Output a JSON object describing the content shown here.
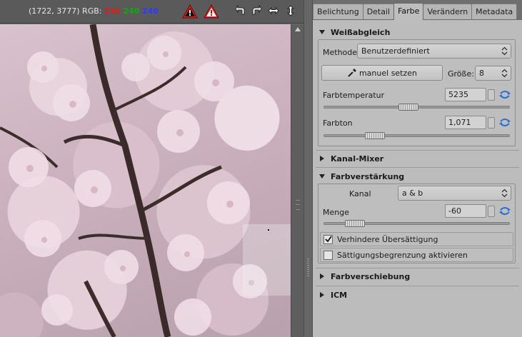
{
  "toolbar": {
    "readout_prefix": "(1722, 3777) RGB:",
    "r": "240",
    "g": "240",
    "b": "240"
  },
  "tabs": [
    {
      "label": "Belichtung"
    },
    {
      "label": "Detail"
    },
    {
      "label": "Farbe",
      "active": true
    },
    {
      "label": "Verändern"
    },
    {
      "label": "Metadata"
    }
  ],
  "white_balance": {
    "title": "Weißabgleich",
    "method_label": "Methode",
    "method_value": "Benutzerdefiniert",
    "pick_button": "manuel setzen",
    "size_label": "Größe:",
    "size_value": "8",
    "temperature_label": "Farbtemperatur",
    "temperature_value": "5235",
    "temperature_slider_pos": 0.45,
    "tint_label": "Farbton",
    "tint_value": "1,071",
    "tint_slider_pos": 0.25
  },
  "channel_mixer": {
    "title": "Kanal-Mixer"
  },
  "vibrance": {
    "title": "Farbverstärkung",
    "channel_label": "Kanal",
    "channel_value": "a & b",
    "amount_label": "Menge",
    "amount_value": "-60",
    "amount_slider_pos": 0.13,
    "prevent_saturation_label": "Verhindere Übersättigung",
    "prevent_saturation_checked": true,
    "saturation_limit_label": "Sättigungsbegrenzung aktivieren",
    "saturation_limit_checked": false
  },
  "color_shift": {
    "title": "Farbverschiebung"
  },
  "icm": {
    "title": "ICM"
  },
  "colors": {
    "red": "#e21b1b",
    "green": "#15a515",
    "blue": "#2b3cff",
    "panel_bg": "#bcbcbc",
    "reset_icon": "#2a6fd6"
  }
}
